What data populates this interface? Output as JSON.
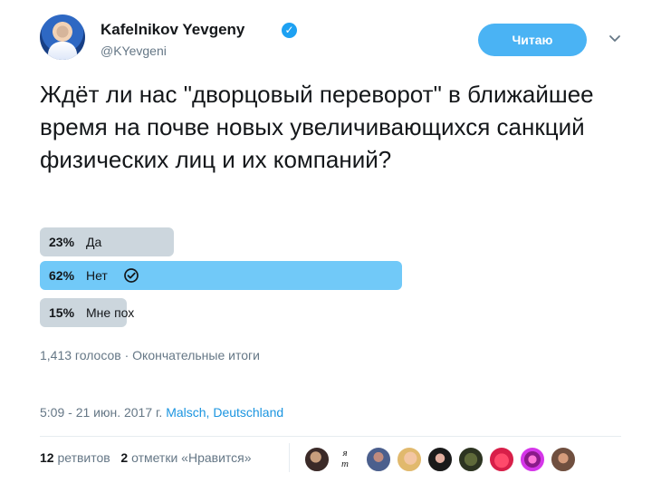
{
  "author": {
    "name": "Kafelnikov Yevgeny",
    "handle": "@KYevgeni",
    "verified_icon": "verified-badge-icon"
  },
  "follow": {
    "label": "Читаю"
  },
  "tweet": {
    "question": "Ждёт ли нас \"дворцовый переворот\" в ближайшее время на почве новых увеличивающихся санкций физических лиц и их компаний?"
  },
  "poll": {
    "options": [
      {
        "percent": "23%",
        "label": "Да",
        "share": 0.23,
        "selected": false
      },
      {
        "percent": "62%",
        "label": "Нет",
        "share": 0.62,
        "selected": true
      },
      {
        "percent": "15%",
        "label": "Мне пох",
        "share": 0.15,
        "selected": false
      }
    ],
    "votes": "1,413 голосов",
    "separator": "·",
    "status": "Окончательные итоги"
  },
  "meta": {
    "time": "5:09 - 21 июн. 2017 г.",
    "location": "Malsch, Deutschland"
  },
  "stats": {
    "retweets_count": "12",
    "retweets_label": "ретвитов",
    "likes_count": "2",
    "likes_label": "отметки «Нравится»"
  },
  "liker_avatar_text": "я\nm",
  "colors": {
    "accent": "#1da1f2",
    "button": "#4ab3f4",
    "poll_winner": "#71c9f8",
    "poll_other": "#ccd6dd",
    "muted_text": "#657786",
    "location": "#1b95e0"
  }
}
